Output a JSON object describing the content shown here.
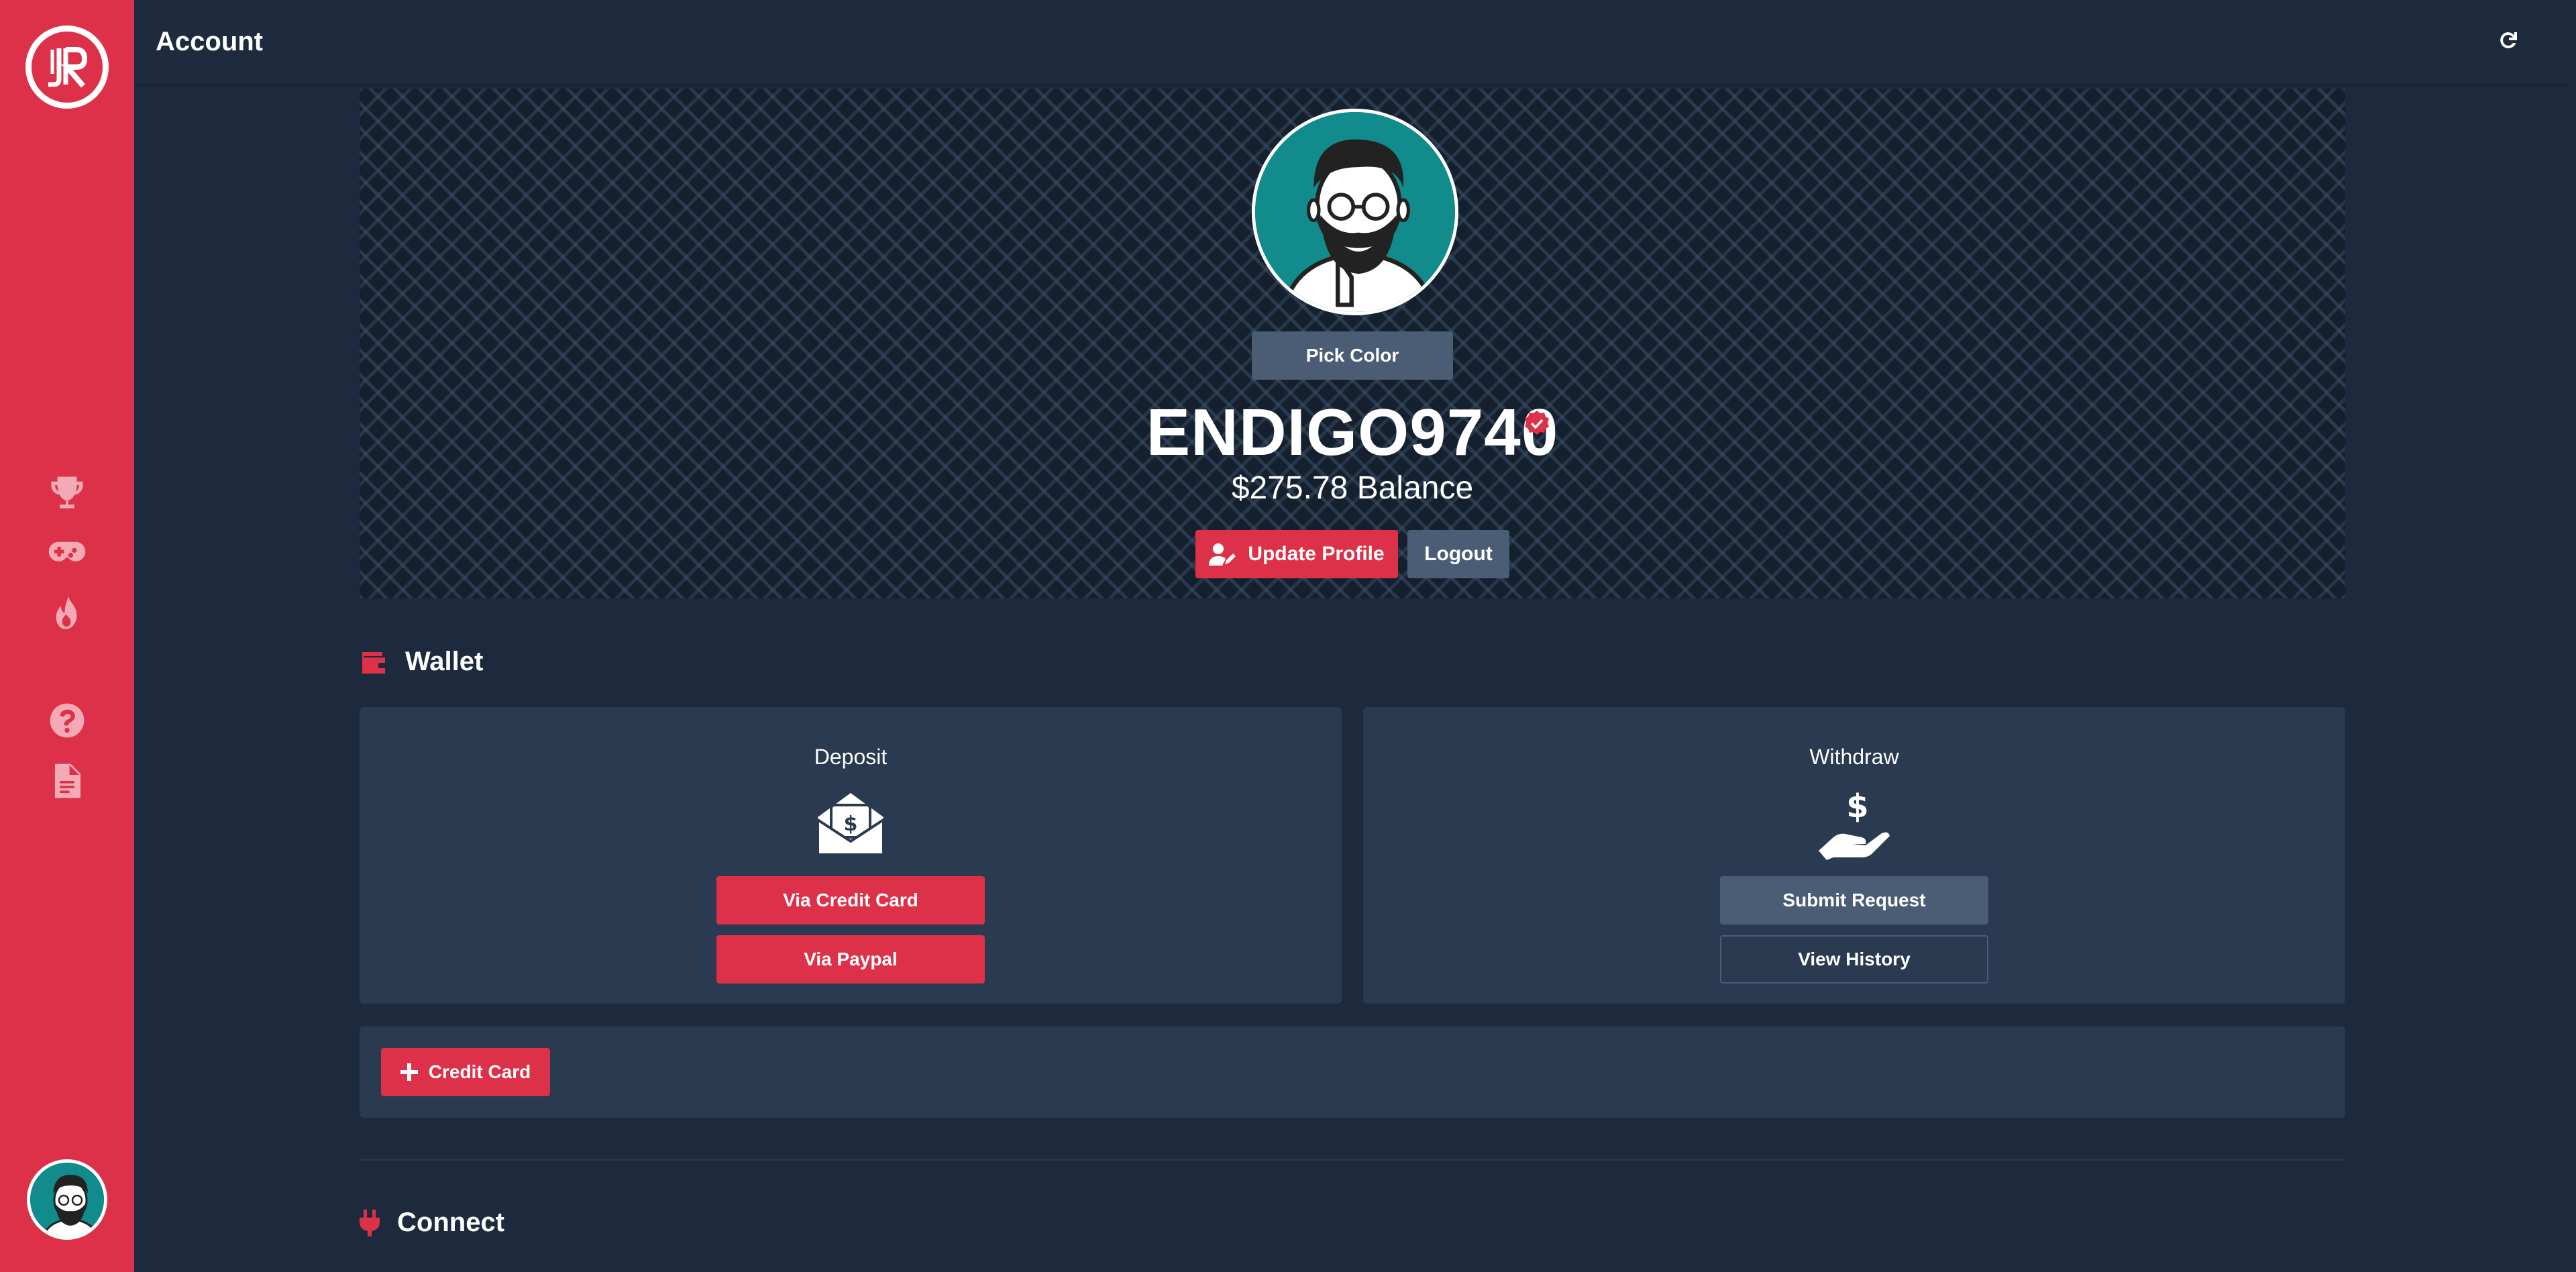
{
  "header": {
    "title": "Account",
    "refresh_icon": "refresh-icon"
  },
  "sidebar": {
    "logo_icon": "logo-icon",
    "items": [
      {
        "icon": "trophy-icon"
      },
      {
        "icon": "gamepad-icon"
      },
      {
        "icon": "fire-icon"
      },
      {
        "icon": "question-icon"
      },
      {
        "icon": "document-icon"
      }
    ]
  },
  "profile": {
    "pick_color_label": "Pick Color",
    "username": "ENDIGO9740",
    "balance": "$275.78 Balance",
    "update_label": "Update Profile",
    "logout_label": "Logout"
  },
  "wallet": {
    "title": "Wallet",
    "deposit": {
      "title": "Deposit",
      "credit_card_label": "Via Credit Card",
      "paypal_label": "Via Paypal"
    },
    "withdraw": {
      "title": "Withdraw",
      "submit_label": "Submit Request",
      "history_label": "View History"
    },
    "add_card_label": "Credit Card"
  },
  "connect": {
    "title": "Connect"
  },
  "colors": {
    "accent": "#dc3148",
    "background": "#1d2a3d",
    "card": "#2a3a51",
    "slate_button": "#4b5d75",
    "avatar_bg": "#128b8c"
  }
}
